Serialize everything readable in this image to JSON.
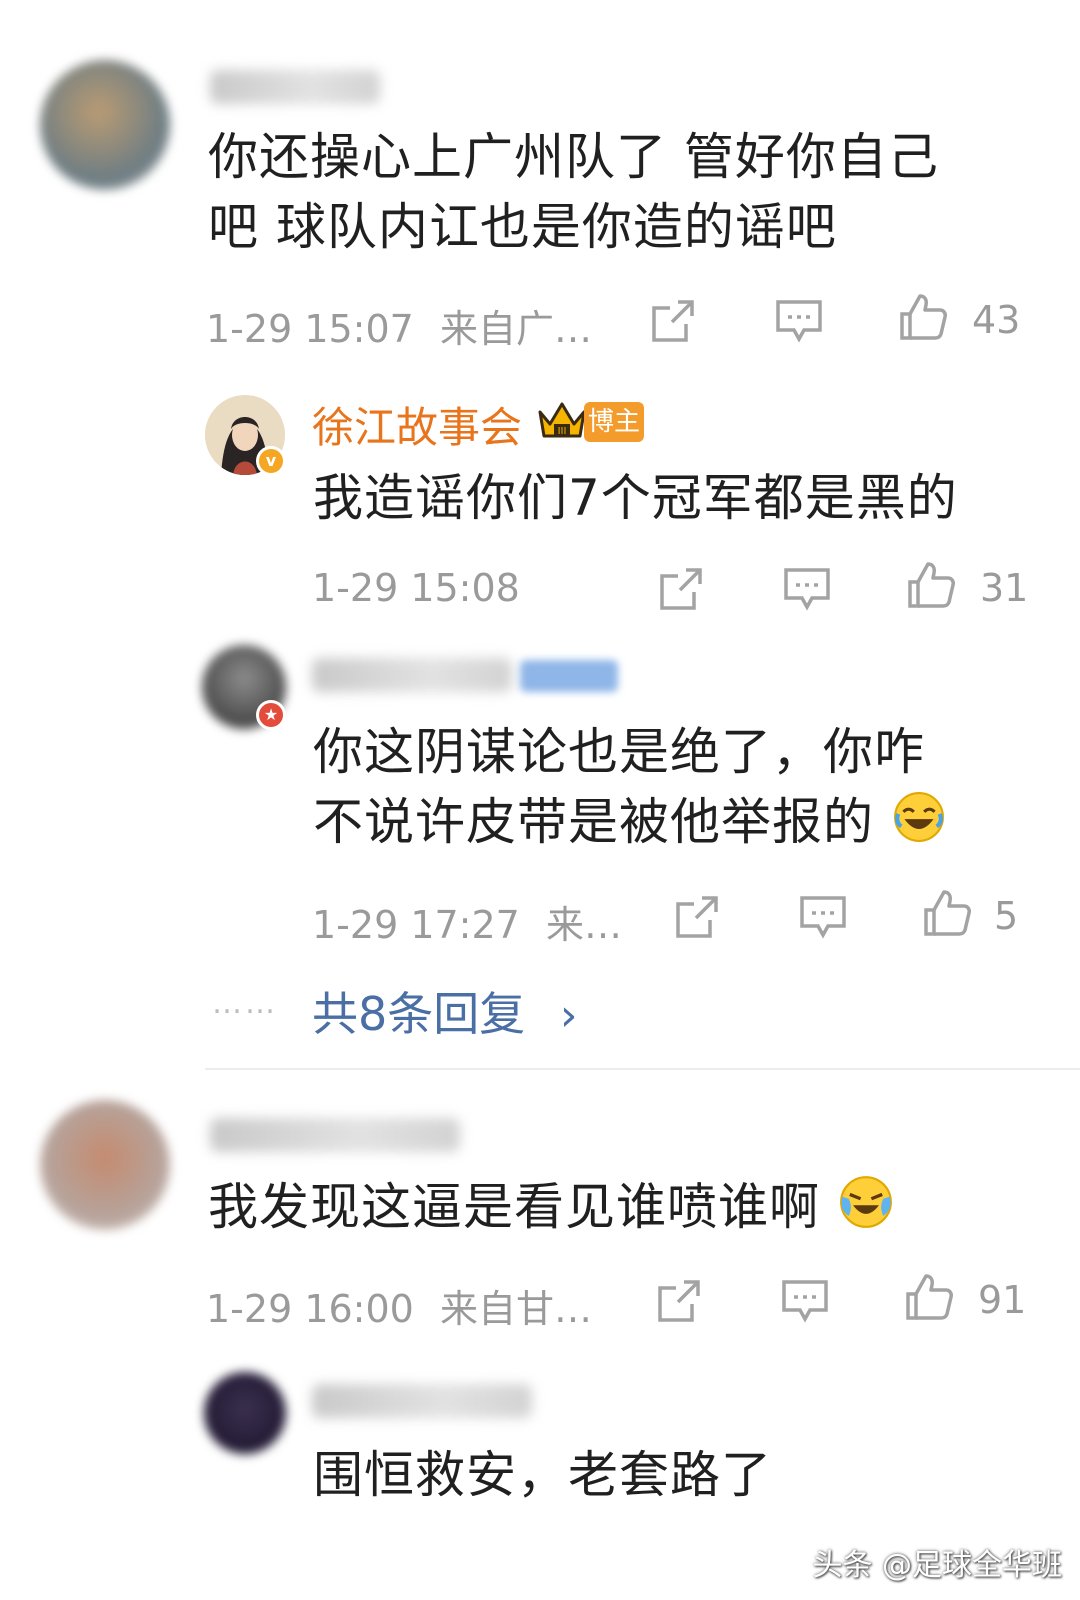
{
  "comments": [
    {
      "text_line1": "你还操心上广州队了 管好你自己",
      "text_line2": "吧 球队内讧也是你造的谣吧",
      "time": "1-29 15:07",
      "source": "来自广…",
      "likes": "43"
    },
    {
      "text_line1": "我发现这逼是看见谁喷谁啊",
      "time": "1-29 16:00",
      "source": "来自甘…",
      "likes": "91"
    }
  ],
  "replies": [
    {
      "author": "徐江故事会",
      "author_badge": "博主",
      "text_line1": "我造谣你们7个冠军都是黑的",
      "time": "1-29 15:08",
      "likes": "31"
    },
    {
      "text_line1": "你这阴谋论也是绝了，你咋",
      "text_line2": "不说许皮带是被他举报的",
      "time": "1-29 17:27",
      "source": "来…",
      "likes": "5"
    },
    {
      "text_line1": "围恒救安，老套路了"
    }
  ],
  "more_replies": {
    "dots": "……",
    "label": "共8条回复",
    "chevron": "›"
  },
  "watermark": "头条 @足球全华班",
  "colors": {
    "blogger_name": "#e8741c",
    "badge_bg": "#f39c2c",
    "link": "#4a6fa5",
    "meta": "#9a9a9a"
  },
  "icons": [
    "share-icon",
    "comment-icon",
    "like-icon",
    "verified-icon",
    "crown-icon",
    "laugh-emoji",
    "cry-laugh-emoji",
    "chevron-right-icon"
  ]
}
